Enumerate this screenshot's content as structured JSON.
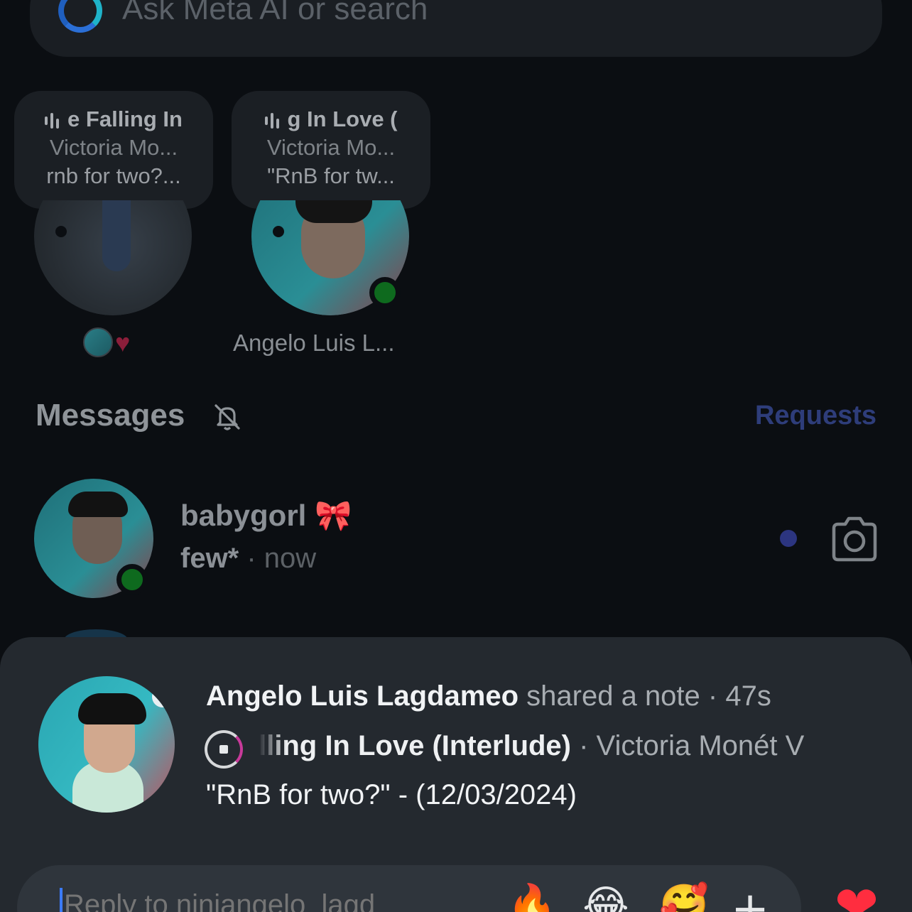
{
  "search": {
    "placeholder": "Ask Meta AI or search"
  },
  "notes": [
    {
      "line1": "e Falling In",
      "line2": "Victoria Mo...",
      "line3": "rnb for two?..."
    },
    {
      "line1": "g In Love (",
      "line2": "Victoria Mo...",
      "line3": "\"RnB for tw..."
    }
  ],
  "stories": [
    {
      "label": ""
    },
    {
      "label": "Angelo Luis L..."
    }
  ],
  "messages": {
    "title": "Messages",
    "requests_label": "Requests"
  },
  "threads": [
    {
      "name": "babygorl",
      "name_emoji": "🎀",
      "preview": "few*",
      "time": " · now"
    }
  ],
  "sheet": {
    "name": "Angelo Luis Lagdameo",
    "action": " shared a note · 47s",
    "song": "lling In Love (Interlude)",
    "artist": " · Victoria Monét  V",
    "note_text": "\"RnB for two?\" - (12/03/2024)"
  },
  "reply": {
    "placeholder": "Reply to ninjangelo_lagd",
    "emojis": [
      "🔥",
      "😂",
      "🥰"
    ],
    "plus": "+",
    "heart": "❤"
  },
  "colors": {
    "online": "#0e6a1e",
    "accent_blue": "#3b7bff",
    "heart_red": "#ff2d3f",
    "progress_pink": "#c83a9a"
  }
}
